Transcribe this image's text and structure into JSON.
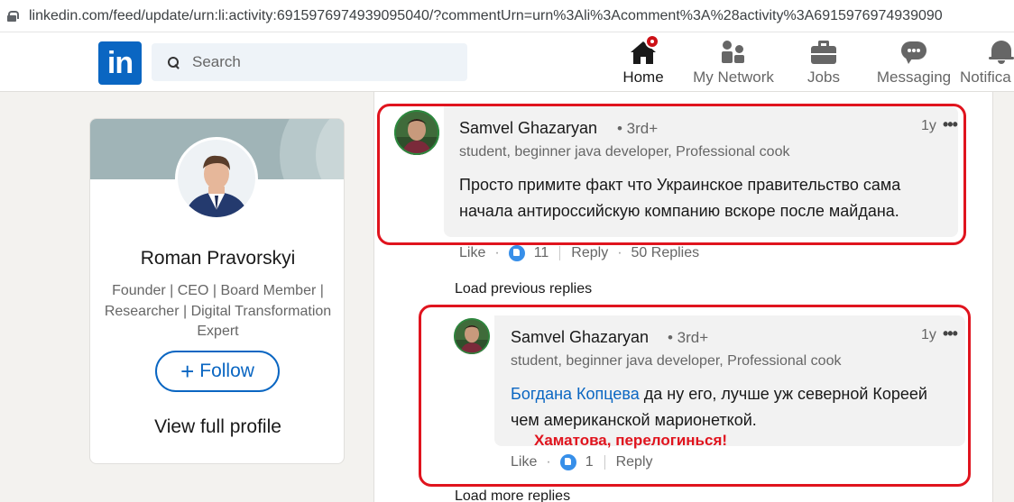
{
  "browser": {
    "url": "linkedin.com/feed/update/urn:li:activity:6915976974939095040/?commentUrn=urn%3Ali%3Acomment%3A%28activity%3A6915976974939090"
  },
  "nav": {
    "logo": "in",
    "search_placeholder": "Search",
    "items": [
      {
        "label": "Home",
        "icon": "home-icon"
      },
      {
        "label": "My Network",
        "icon": "network-icon"
      },
      {
        "label": "Jobs",
        "icon": "briefcase-icon"
      },
      {
        "label": "Messaging",
        "icon": "messaging-icon"
      },
      {
        "label": "Notifica",
        "icon": "bell-icon"
      }
    ]
  },
  "profile": {
    "name": "Roman Pravorskyi",
    "headline": "Founder | CEO | Board Member | Researcher | Digital Transformation Expert",
    "follow_label": "Follow",
    "view_profile_label": "View full profile"
  },
  "comments": [
    {
      "author": "Samvel Ghazaryan",
      "degree": "• 3rd+",
      "time": "1y",
      "headline": "student, beginner java developer, Professional cook",
      "text": "Просто примите факт что Украинское правительство сама начала антироссийскую компанию вскоре после майдана.",
      "like_label": "Like",
      "reactions": "11",
      "reply_label": "Reply",
      "replies_count": "50 Replies"
    },
    {
      "author": "Samvel Ghazaryan",
      "degree": "• 3rd+",
      "time": "1y",
      "headline": "student, beginner java developer, Professional cook",
      "mention": "Богдана Копцева",
      "text": " да ну его, лучше уж северной Кореей чем американской марионеткой.",
      "like_label": "Like",
      "reactions": "1",
      "reply_label": "Reply"
    }
  ],
  "load_previous": "Load previous replies",
  "load_more": "Load more replies",
  "annotation": "Хаматова, перелогинься!",
  "colors": {
    "brand": "#0a66c2",
    "annotation_red": "#e0141e",
    "notification_badge": "#cc1016"
  }
}
